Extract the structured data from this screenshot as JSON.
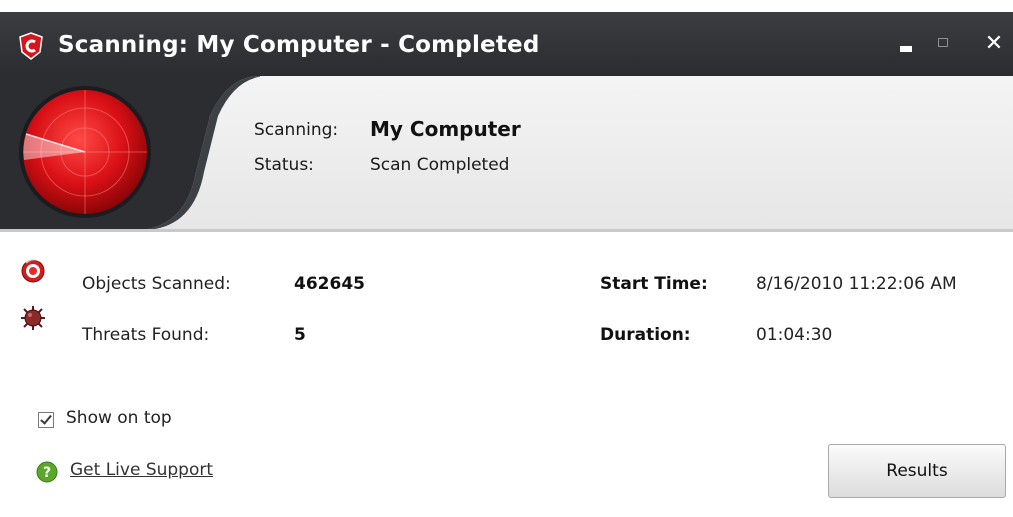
{
  "window": {
    "title": "Scanning: My Computer - Completed",
    "icons": {
      "app": "comodo-shield-icon",
      "minimize": "minimize-icon",
      "maximize": "maximize-icon",
      "close": "close-icon",
      "close_glyph": "✕"
    }
  },
  "header": {
    "scanning_label": "Scanning:",
    "scanning_value": "My Computer",
    "status_label": "Status:",
    "status_value": "Scan Completed",
    "radar_icon": "radar-icon"
  },
  "stats": {
    "objects_scanned_label": "Objects Scanned:",
    "objects_scanned_value": "462645",
    "threats_found_label": "Threats Found:",
    "threats_found_value": "5",
    "start_time_label": "Start Time:",
    "start_time_value": "8/16/2010 11:22:06 AM",
    "duration_label": "Duration:",
    "duration_value": "01:04:30",
    "icons": {
      "objects": "scan-target-icon",
      "threats": "virus-icon"
    }
  },
  "footer": {
    "show_on_top_label": "Show on top",
    "show_on_top_checked": true,
    "support_link": "Get Live Support",
    "help_icon": "help-icon",
    "results_button": "Results"
  },
  "colors": {
    "titlebar": "#2e3034",
    "radar_red": "#e0141a",
    "header_panel": "#ececec",
    "help_green": "#5aa72a"
  }
}
